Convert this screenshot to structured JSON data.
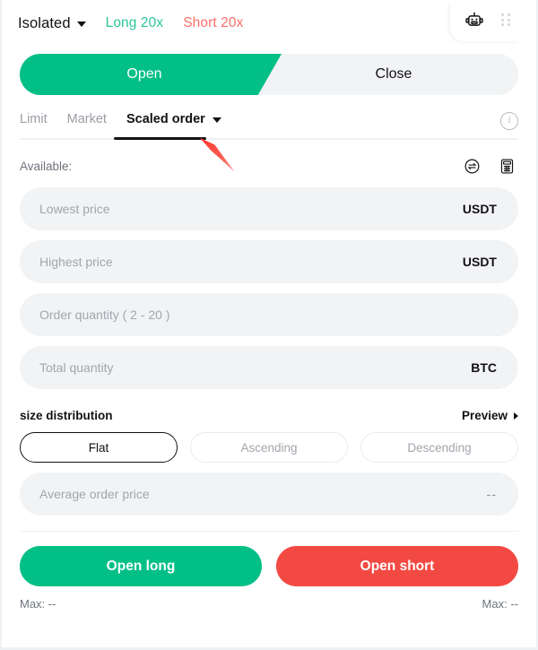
{
  "topbar": {
    "margin_mode": "Isolated",
    "long_leverage": "Long 20x",
    "short_leverage": "Short 20x",
    "bot_icon": "robot-icon",
    "grid_icon": "grid-dots-icon"
  },
  "side_tabs": {
    "open": "Open",
    "close": "Close",
    "active": "Open"
  },
  "order_types": {
    "items": [
      {
        "label": "Limit",
        "active": false
      },
      {
        "label": "Market",
        "active": false
      },
      {
        "label": "Scaled order",
        "active": true
      }
    ],
    "info_icon": "info-circle-icon"
  },
  "available": {
    "label": "Available:",
    "value": "",
    "transfer_icon": "transfer-circle-icon",
    "calculator_icon": "calculator-icon"
  },
  "fields": [
    {
      "placeholder": "Lowest price",
      "value": "",
      "unit": "USDT"
    },
    {
      "placeholder": "Highest price",
      "value": "",
      "unit": "USDT"
    },
    {
      "placeholder": "Order quantity ( 2 - 20 )",
      "value": "",
      "unit": ""
    },
    {
      "placeholder": "Total quantity",
      "value": "",
      "unit": "BTC"
    }
  ],
  "size_distribution": {
    "title": "size distribution",
    "preview": "Preview",
    "options": [
      {
        "label": "Flat",
        "selected": true
      },
      {
        "label": "Ascending",
        "selected": false
      },
      {
        "label": "Descending",
        "selected": false
      }
    ]
  },
  "average_order_price": {
    "placeholder": "Average order price",
    "value": "--"
  },
  "actions": {
    "long_label": "Open long",
    "short_label": "Open short",
    "max_long": "Max: --",
    "max_short": "Max: --"
  },
  "colors": {
    "green": "#02bf86",
    "green_text": "#2bc79a",
    "red": "#f24a43",
    "red_text": "#f97068",
    "field_bg": "#f2f3f5",
    "text_primary": "#121214",
    "text_muted": "#9a9da5"
  }
}
